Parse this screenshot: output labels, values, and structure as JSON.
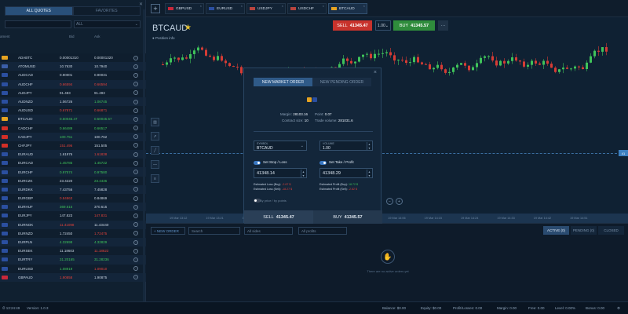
{
  "left_panel": {
    "tabs": [
      "ALL QUOTES",
      "FAVORITES"
    ],
    "search_value": "",
    "filter_value": "ALL",
    "columns": {
      "name": "ament",
      "bid": "Bid",
      "ask": "Ask"
    },
    "quotes": [
      {
        "symbol": "ADABTC",
        "bid": "0.00001310",
        "ask": "0.00001320",
        "bid_dir": "neu",
        "ask_dir": "neu",
        "flag": "#e6a321"
      },
      {
        "symbol": "ATOMUSD",
        "bid": "10.7630",
        "ask": "10.7940",
        "bid_dir": "neu",
        "ask_dir": "neu",
        "flag": "#3b5ea8"
      },
      {
        "symbol": "AUDCAD",
        "bid": "0.90001",
        "ask": "0.90031",
        "bid_dir": "neu",
        "ask_dir": "neu",
        "flag": "#2b4fa0"
      },
      {
        "symbol": "AUDCHF",
        "bid": "0.66594",
        "ask": "0.66594",
        "bid_dir": "down",
        "ask_dir": "down",
        "flag": "#2b4fa0"
      },
      {
        "symbol": "AUDJPY",
        "bid": "91.483",
        "ask": "91.493",
        "bid_dir": "neu",
        "ask_dir": "neu",
        "flag": "#2b4fa0"
      },
      {
        "symbol": "AUDNZD",
        "bid": "1.06726",
        "ask": "1.06745",
        "bid_dir": "neu",
        "ask_dir": "up",
        "flag": "#2b4fa0"
      },
      {
        "symbol": "AUDUSD",
        "bid": "0.67871",
        "ask": "0.66871",
        "bid_dir": "down",
        "ask_dir": "down",
        "flag": "#2b4fa0"
      },
      {
        "symbol": "BTCAUD",
        "bid": "0.50045.47",
        "ask": "0.50045.57",
        "bid_dir": "up",
        "ask_dir": "up",
        "flag": "#e6a321"
      },
      {
        "symbol": "CADCHF",
        "bid": "0.66489",
        "ask": "0.66517",
        "bid_dir": "up",
        "ask_dir": "up",
        "flag": "#d22f27"
      },
      {
        "symbol": "CADJPY",
        "bid": "100.751",
        "ask": "100.762",
        "bid_dir": "up",
        "ask_dir": "neu",
        "flag": "#d22f27"
      },
      {
        "symbol": "CHFJPY",
        "bid": "151.496",
        "ask": "151.505",
        "bid_dir": "down",
        "ask_dir": "neu",
        "flag": "#d22f27"
      },
      {
        "symbol": "EURAUD",
        "bid": "1.61976",
        "ask": "1.61838",
        "bid_dir": "neu",
        "ask_dir": "down",
        "flag": "#2b4fa0"
      },
      {
        "symbol": "EURCAD",
        "bid": "1.45785",
        "ask": "1.45722",
        "bid_dir": "up",
        "ask_dir": "up",
        "flag": "#2b4fa0"
      },
      {
        "symbol": "EURCHF",
        "bid": "0.97574",
        "ask": "0.97580",
        "bid_dir": "up",
        "ask_dir": "up",
        "flag": "#2b4fa0"
      },
      {
        "symbol": "EURCZK",
        "bid": "23.4220",
        "ask": "23.4436",
        "bid_dir": "neu",
        "ask_dir": "up",
        "flag": "#2b4fa0"
      },
      {
        "symbol": "EURDKK",
        "bid": "7.43756",
        "ask": "7.45828",
        "bid_dir": "neu",
        "ask_dir": "neu",
        "flag": "#2b4fa0"
      },
      {
        "symbol": "EURGBP",
        "bid": "0.84863",
        "ask": "0.84869",
        "bid_dir": "down",
        "ask_dir": "neu",
        "flag": "#2b4fa0"
      },
      {
        "symbol": "EURHUF",
        "bid": "369.615",
        "ask": "370.615",
        "bid_dir": "up",
        "ask_dir": "neu",
        "flag": "#2b4fa0"
      },
      {
        "symbol": "EURJPY",
        "bid": "147.823",
        "ask": "147.831",
        "bid_dir": "neu",
        "ask_dir": "down",
        "flag": "#2b4fa0"
      },
      {
        "symbol": "EURNOK",
        "bid": "11.41098",
        "ask": "11.43440",
        "bid_dir": "down",
        "ask_dir": "neu",
        "flag": "#2b4fa0"
      },
      {
        "symbol": "EURNZD",
        "bid": "1.72450",
        "ask": "1.72475",
        "bid_dir": "neu",
        "ask_dir": "down",
        "flag": "#2b4fa0"
      },
      {
        "symbol": "EURPLN",
        "bid": "4.32698",
        "ask": "4.32829",
        "bid_dir": "up",
        "ask_dir": "up",
        "flag": "#2b4fa0"
      },
      {
        "symbol": "EURSEK",
        "bid": "11.18603",
        "ask": "11.18622",
        "bid_dir": "neu",
        "ask_dir": "down",
        "flag": "#2b4fa0"
      },
      {
        "symbol": "EURTRY",
        "bid": "31.20165",
        "ask": "31.28236",
        "bid_dir": "up",
        "ask_dir": "up",
        "flag": "#2b4fa0"
      },
      {
        "symbol": "EURUSD",
        "bid": "1.08919",
        "ask": "1.09010",
        "bid_dir": "up",
        "ask_dir": "down",
        "flag": "#2b4fa0"
      },
      {
        "symbol": "GBPAUD",
        "bid": "1.90858",
        "ask": "1.90875",
        "bid_dir": "down",
        "ask_dir": "neu",
        "flag": "#c8283a"
      }
    ]
  },
  "top_tabs": [
    {
      "label": "GBPUSD",
      "active": false,
      "flag": "#c8283a"
    },
    {
      "label": "EURUSD",
      "active": false,
      "flag": "#2b4fa0"
    },
    {
      "label": "USDJPY",
      "active": false,
      "flag": "#b8443e"
    },
    {
      "label": "USDCHF",
      "active": false,
      "flag": "#b8443e"
    },
    {
      "label": "BTCAUD",
      "active": true,
      "flag": "#e6a321"
    }
  ],
  "chart": {
    "symbol": "BTCAUD",
    "position_info": "Position info",
    "sell_label": "SELL",
    "sell_price": "41345.47",
    "lot": "1.00",
    "buy_label": "BUY",
    "buy_price": "41345.57",
    "more": "···",
    "price_tag": "41",
    "time_labels": [
      "19 Mar 13:12",
      "19 Mar 13:21",
      "19 Mar 13:30",
      "19 Mar 13:39",
      "19 Mar 13:48",
      "19 Mar 13:57",
      "19 Mar 14:06",
      "19 Mar 14:15",
      "19 Mar 14:24",
      "19 Mar 14:33",
      "19 Mar 14:42",
      "19 Mar 14:51"
    ]
  },
  "modal": {
    "tab_market": "NEW MARKET ORDER",
    "tab_pending": "NEW PENDING ORDER",
    "close": "×",
    "margin_label": "Margin:",
    "margin_value": "28103.16",
    "point_label": "Point:",
    "point_value": "0.07",
    "contract_label": "Contract size:",
    "contract_value": "10",
    "trade_volume_label": "Trade volume:",
    "trade_volume_value": "281031.6",
    "symbol_label": "SYMBOL",
    "symbol_value": "BTCAUD",
    "volume_label": "VOLUME",
    "volume_value": "1.00",
    "sl_label": "Set Stop / Loss",
    "sl_value": "41348.14",
    "tp_label": "Set Take / Profit",
    "tp_value": "41348.29",
    "est_loss_buy_label": "Estimated Loss (Buy):",
    "est_loss_buy": "-2.67 $",
    "est_loss_sell_label": "Estimated Loss (Sell):",
    "est_loss_sell": "-18.27 $",
    "est_profit_buy_label": "Estimated Profit (Buy):",
    "est_profit_buy": "18.72 $",
    "est_profit_sell_label": "Estimated Profit (Sell):",
    "est_profit_sell": "-2.82 $",
    "by_price": "By price / by points",
    "sell_label": "SELL",
    "sell_price": "41345.47",
    "buy_label": "BUY",
    "buy_price": "41345.57"
  },
  "bottom_panel": {
    "new_order": "+ NEW ORDER",
    "search_placeholder": "Search",
    "sides": "All sides",
    "profits": "All profits",
    "tab_active": "ACTIVE (0)",
    "tab_pending": "PENDING (0)",
    "tab_closed": "CLOSED",
    "empty_text": "There are no active orders yet"
  },
  "status_bar": {
    "clock": "13:24:49",
    "version": "Version: 1.0.3",
    "balance_label": "Balance:",
    "balance": "$0.00",
    "equity_label": "Equity:",
    "equity": "$0.00",
    "pl_label": "Profit/Losses:",
    "pl": "0.00",
    "margin_label": "Margin:",
    "margin": "0.00",
    "free_label": "Free:",
    "free": "0.00",
    "level_label": "Level:",
    "level": "0.00%",
    "bonus_label": "Bonus:",
    "bonus": "0.00"
  },
  "colors": {
    "up": "#3fc35a",
    "down": "#e0413a",
    "accent": "#2f5a88",
    "sell": "#c8322c",
    "buy": "#2f8c3c"
  }
}
